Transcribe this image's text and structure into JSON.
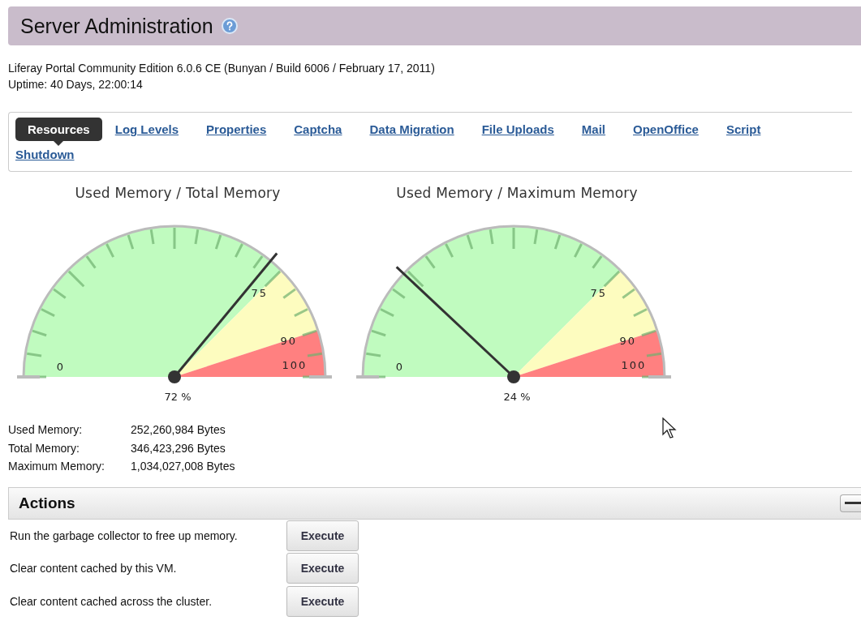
{
  "header": {
    "title": "Server Administration"
  },
  "info": [
    "Liferay Portal Community Edition 6.0.6 CE (Bunyan / Build 6006 / February 17, 2011)",
    "Uptime: 40 Days, 22:00:14"
  ],
  "tabs": [
    {
      "label": "Resources",
      "selected": true
    },
    {
      "label": "Log Levels",
      "selected": false
    },
    {
      "label": "Properties",
      "selected": false
    },
    {
      "label": "Captcha",
      "selected": false
    },
    {
      "label": "Data Migration",
      "selected": false
    },
    {
      "label": "File Uploads",
      "selected": false
    },
    {
      "label": "Mail",
      "selected": false
    },
    {
      "label": "OpenOffice",
      "selected": false
    },
    {
      "label": "Script",
      "selected": false
    },
    {
      "label": "Shutdown",
      "selected": false
    }
  ],
  "gauges": [
    {
      "title": "Used Memory / Total Memory",
      "level": 0.72,
      "reading": "72 %",
      "scale_labels": [
        "0",
        "75",
        "90",
        "100"
      ]
    },
    {
      "title": "Used Memory / Maximum Memory",
      "level": 0.24,
      "reading": "24 %",
      "scale_labels": [
        "0",
        "75",
        "90",
        "100"
      ]
    }
  ],
  "memory": [
    {
      "label": "Used Memory:",
      "value": "252,260,984 Bytes"
    },
    {
      "label": "Total Memory:",
      "value": "346,423,296 Bytes"
    },
    {
      "label": "Maximum Memory:",
      "value": "1,034,027,008 Bytes"
    }
  ],
  "actions": {
    "title": "Actions",
    "rows": [
      {
        "text": "Run the garbage collector to free up memory.",
        "button": "Execute"
      },
      {
        "text": "Clear content cached by this VM.",
        "button": "Execute"
      },
      {
        "text": "Clear content cached across the cluster.",
        "button": "Execute"
      }
    ]
  }
}
